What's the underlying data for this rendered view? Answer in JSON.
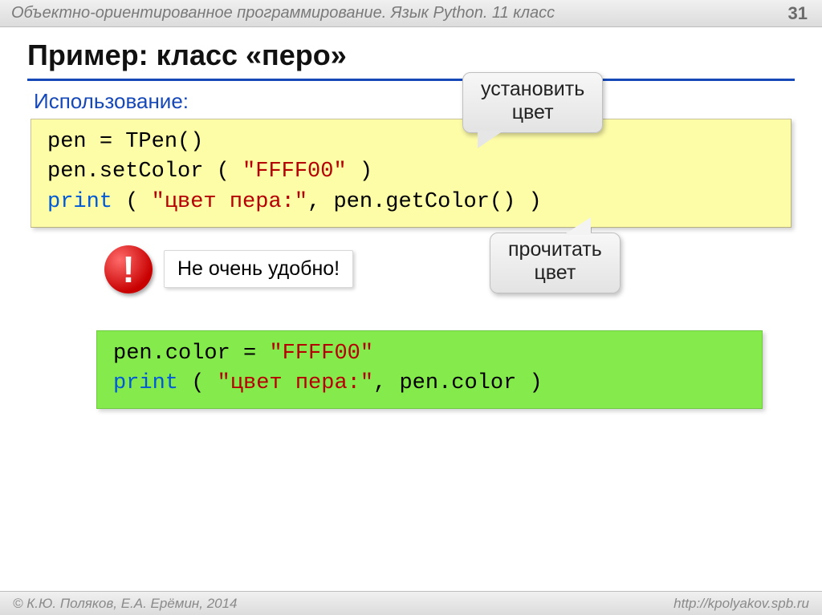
{
  "header": {
    "course": "Объектно-ориентированное программирование. Язык Python. 11 класс",
    "page": "31"
  },
  "title": "Пример: класс «перо»",
  "section": "Использование:",
  "callouts": {
    "set_color_line1": "установить",
    "set_color_line2": "цвет",
    "get_color_line1": "прочитать",
    "get_color_line2": "цвет"
  },
  "code_yellow": {
    "l1_a": "pen",
    "l1_b": "=",
    "l1_c": "TPen()",
    "l2_a": "pen.setColor",
    "l2_b": "(",
    "l2_c": "\"FFFF00\"",
    "l2_d": ")",
    "l3_a": "print",
    "l3_b": "(",
    "l3_c": "\"цвет пера:\"",
    "l3_d": ", pen.getColor()",
    "l3_e": ")"
  },
  "warning": {
    "mark": "!",
    "text": "Не очень удобно!"
  },
  "code_green": {
    "l1_a": "pen.color",
    "l1_b": "=",
    "l1_c": "\"FFFF00\"",
    "l2_a": "print",
    "l2_b": "(",
    "l2_c": "\"цвет пера:\"",
    "l2_d": ", pen.color",
    "l2_e": ")"
  },
  "footer": {
    "left": "© К.Ю. Поляков, Е.А. Ерёмин, 2014",
    "right": "http://kpolyakov.spb.ru"
  }
}
